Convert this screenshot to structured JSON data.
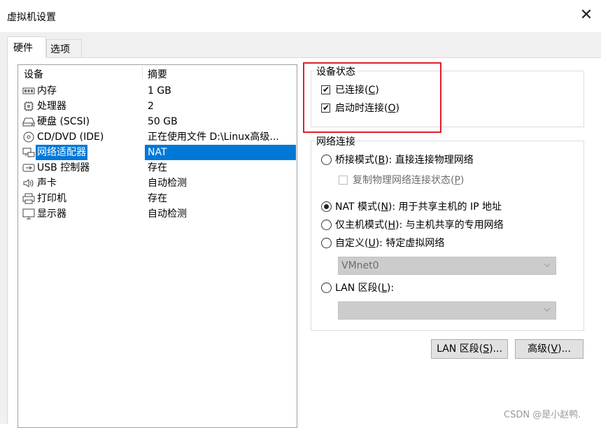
{
  "window": {
    "title": "虚拟机设置"
  },
  "tabs": [
    {
      "label": "硬件",
      "active": true
    },
    {
      "label": "选项",
      "active": false
    }
  ],
  "device_list": {
    "columns": {
      "device": "设备",
      "summary": "摘要"
    },
    "rows": [
      {
        "name": "内存",
        "summary": "1 GB",
        "icon": "memory-icon"
      },
      {
        "name": "处理器",
        "summary": "2",
        "icon": "processor-icon"
      },
      {
        "name": "硬盘 (SCSI)",
        "summary": "50 GB",
        "icon": "hard-disk-icon"
      },
      {
        "name": "CD/DVD (IDE)",
        "summary": "正在使用文件 D:\\Linux高级...",
        "icon": "cd-dvd-icon"
      },
      {
        "name": "网络适配器",
        "summary": "NAT",
        "icon": "network-adapter-icon",
        "selected": true
      },
      {
        "name": "USB 控制器",
        "summary": "存在",
        "icon": "usb-icon"
      },
      {
        "name": "声卡",
        "summary": "自动检测",
        "icon": "sound-card-icon"
      },
      {
        "name": "打印机",
        "summary": "存在",
        "icon": "printer-icon"
      },
      {
        "name": "显示器",
        "summary": "自动检测",
        "icon": "display-icon"
      }
    ]
  },
  "device_status": {
    "label": "设备状态",
    "connected": {
      "pre": "已连接(",
      "key": "C",
      "post": ")",
      "checked": true
    },
    "connect_at_power_on": {
      "pre": "启动时连接(",
      "key": "O",
      "post": ")",
      "checked": true
    }
  },
  "network_connection": {
    "label": "网络连接",
    "bridged": {
      "pre": "桥接模式(",
      "key": "B",
      "post": "): 直接连接物理网络",
      "selected": false
    },
    "replicate": {
      "pre": "复制物理网络连接状态(",
      "key": "P",
      "post": ")",
      "checked": false,
      "enabled": false
    },
    "nat": {
      "pre": "NAT 模式(",
      "key": "N",
      "post": "): 用于共享主机的 IP 地址",
      "selected": true
    },
    "host_only": {
      "pre": "仅主机模式(",
      "key": "H",
      "post": "): 与主机共享的专用网络",
      "selected": false
    },
    "custom": {
      "pre": "自定义(",
      "key": "U",
      "post": "): 特定虚拟网络",
      "selected": false
    },
    "custom_select": {
      "value": "VMnet0",
      "enabled": false
    },
    "lan_segment": {
      "pre": "LAN 区段(",
      "key": "L",
      "post": "):",
      "selected": false
    },
    "lan_select": {
      "value": "",
      "enabled": false
    }
  },
  "buttons": {
    "lan_segments": {
      "pre": "LAN 区段(",
      "key": "S",
      "post": ")..."
    },
    "advanced": {
      "pre": "高级(",
      "key": "V",
      "post": ")..."
    }
  },
  "watermark": "CSDN @是小赵鸭."
}
